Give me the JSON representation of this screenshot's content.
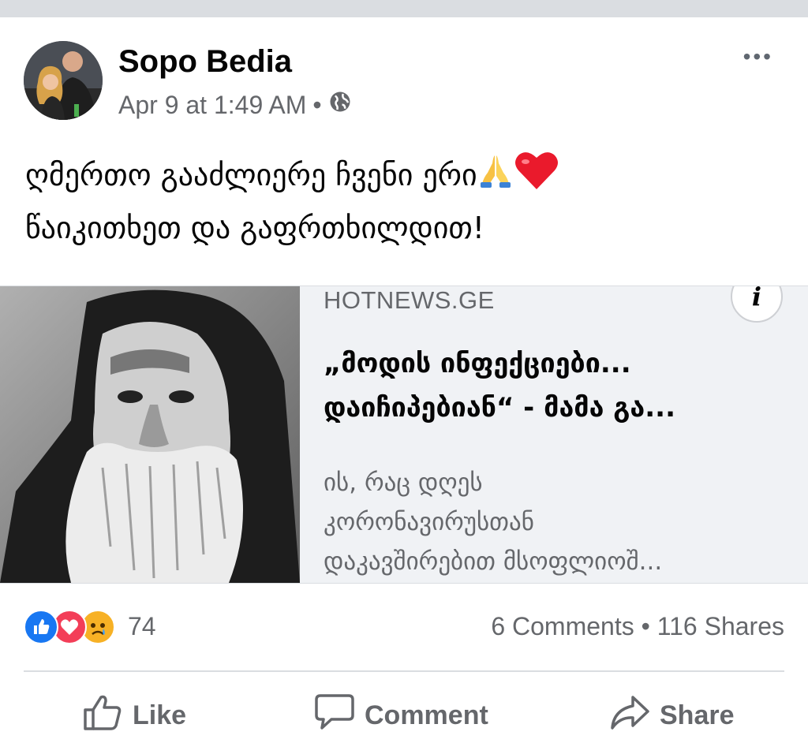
{
  "post": {
    "author": "Sopo Bedia",
    "timestamp": "Apr 9 at 1:49 AM",
    "separator": "•",
    "privacy_icon": "globe-icon",
    "more_label": "•••",
    "text_line1": "ღმერთო გააძლიერე ჩვენი ერი",
    "text_line2": "წაიკითხეთ და გაფრთხილდით!",
    "emojis": [
      "folded-hands-icon",
      "red-heart-icon"
    ]
  },
  "link": {
    "domain": "HOTNEWS.GE",
    "info_label": "i",
    "headline": "„მოდის ინფექციები...\nდაიჩიპებიან“ - მამა გა...",
    "description": "ის, რაც დღეს\nკორონავირუსთან\nდაკავშირებით მსოფლიოშ..."
  },
  "engagement": {
    "reaction_icons": [
      "like-reaction-icon",
      "love-reaction-icon",
      "sad-reaction-icon"
    ],
    "reaction_count": "74",
    "comments": "6 Comments",
    "dot": "•",
    "shares": "116 Shares"
  },
  "actions": {
    "like": "Like",
    "comment": "Comment",
    "share": "Share"
  },
  "colors": {
    "secondary_text": "#65676b",
    "like_blue": "#1877f2",
    "love_red": "#f33e58",
    "sad_yellow": "#f7b125",
    "card_bg": "#f0f2f5"
  }
}
